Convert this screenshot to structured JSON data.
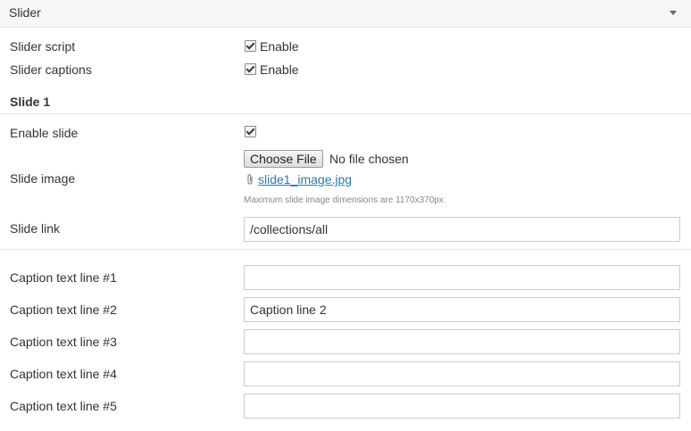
{
  "header": {
    "title": "Slider"
  },
  "settings": {
    "slider_script": {
      "label": "Slider script",
      "option": "Enable"
    },
    "slider_captions": {
      "label": "Slider captions",
      "option": "Enable"
    }
  },
  "slide": {
    "title": "Slide 1",
    "enable": {
      "label": "Enable slide"
    },
    "image": {
      "label": "Slide image",
      "button_label": "Choose File",
      "status": "No file chosen",
      "current_file": "slide1_image.jpg",
      "help": "Maximum slide image dimensions are 1170x370px"
    },
    "link": {
      "label": "Slide link",
      "value": "/collections/all"
    }
  },
  "captions": [
    {
      "label": "Caption text line #1",
      "value": ""
    },
    {
      "label": "Caption text line #2",
      "value": "Caption line 2"
    },
    {
      "label": "Caption text line #3",
      "value": ""
    },
    {
      "label": "Caption text line #4",
      "value": ""
    },
    {
      "label": "Caption text line #5",
      "value": ""
    }
  ]
}
